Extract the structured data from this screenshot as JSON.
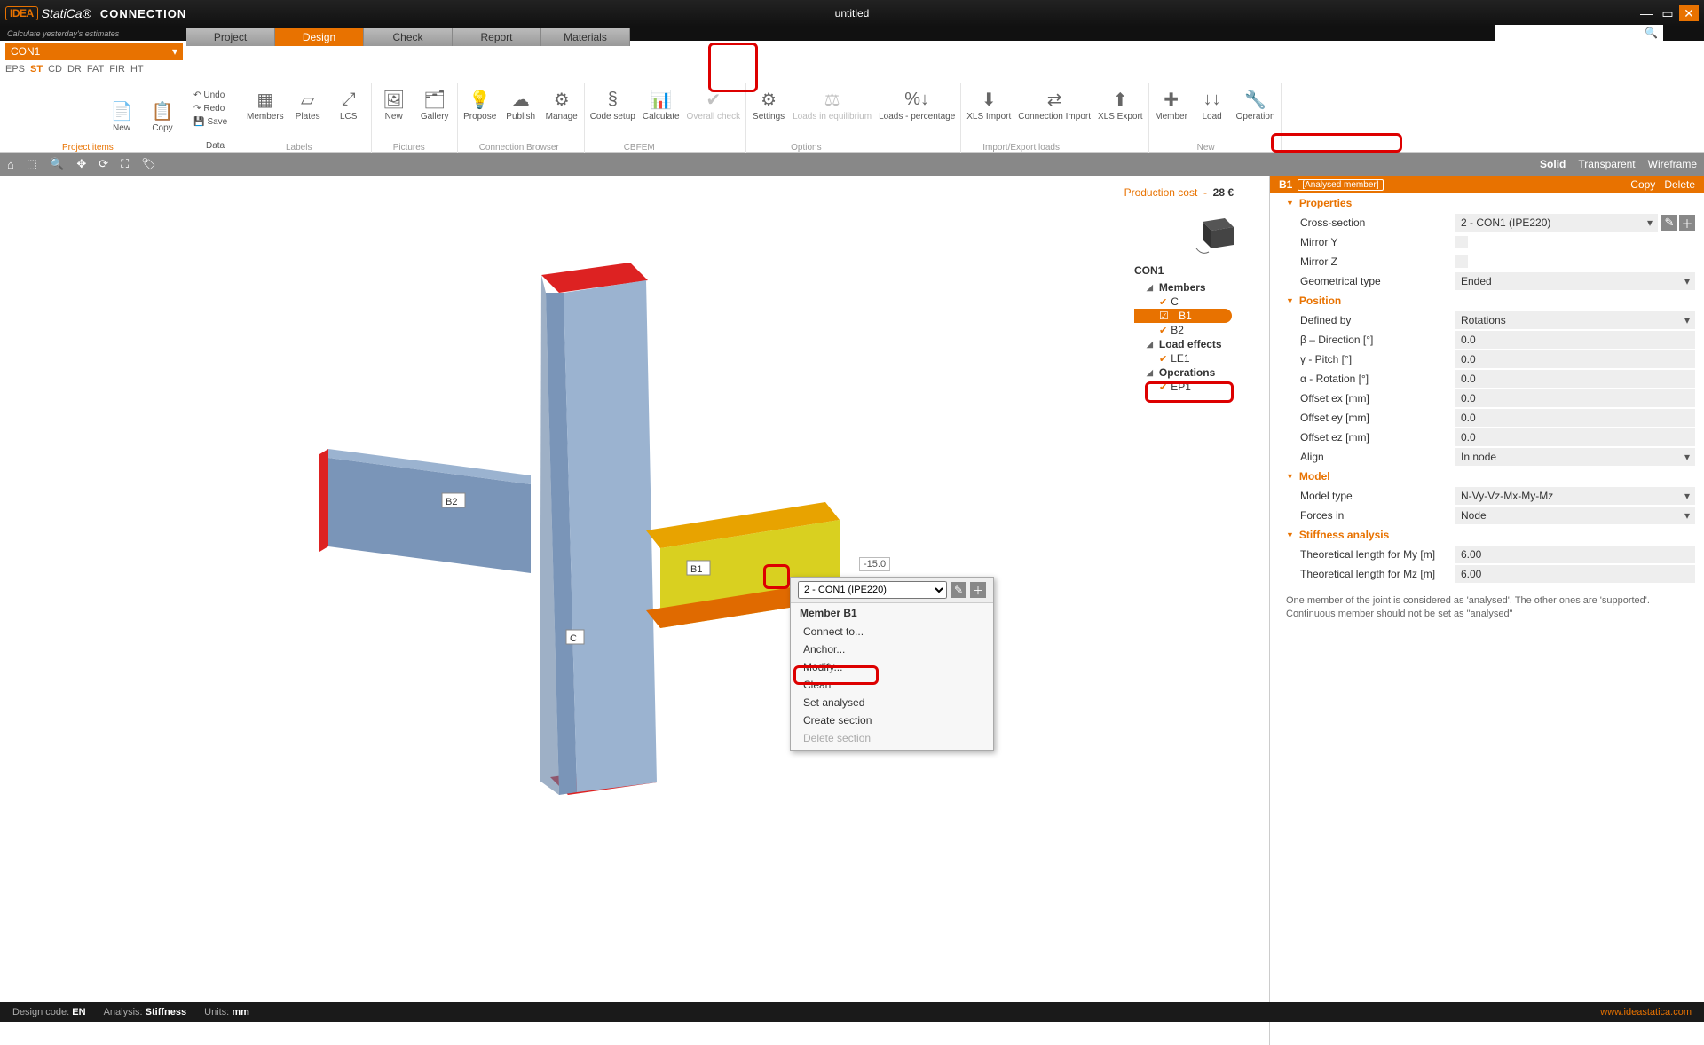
{
  "titlebar": {
    "logo": "IDEA",
    "brand": "StatiCa®",
    "app": "CONNECTION",
    "doc": "untitled",
    "tagline": "Calculate yesterday's estimates"
  },
  "tabs": [
    "Project",
    "Design",
    "Check",
    "Report",
    "Materials"
  ],
  "active_tab": 1,
  "name_box": "CON1",
  "sublabels": [
    "EPS",
    "ST",
    "CD",
    "DR",
    "FAT",
    "FIR",
    "HT"
  ],
  "project_items_label": "Project items",
  "ribbon": {
    "new": "New",
    "copy": "Copy",
    "undo": "Undo",
    "redo": "Redo",
    "save": "Save",
    "members": "Members",
    "plates": "Plates",
    "lcs": "LCS",
    "new2": "New",
    "gallery": "Gallery",
    "propose": "Propose",
    "publish": "Publish",
    "manage": "Manage",
    "codesetup": "Code setup",
    "calculate": "Calculate",
    "overallcheck": "Overall check",
    "settings": "Settings",
    "loadseq": "Loads in equilibrium",
    "loadspct": "Loads - percentage",
    "xlsimp": "XLS Import",
    "connimp": "Connection Import",
    "xlsexp": "XLS Export",
    "member": "Member",
    "load": "Load",
    "operation": "Operation",
    "g_data": "Data",
    "g_labels": "Labels",
    "g_pictures": "Pictures",
    "g_cb": "Connection Browser",
    "g_cbfem": "CBFEM",
    "g_options": "Options",
    "g_ie": "Import/Export loads",
    "g_new": "New"
  },
  "toolbar2": {
    "solid": "Solid",
    "transparent": "Transparent",
    "wireframe": "Wireframe"
  },
  "prod_cost": {
    "label": "Production cost",
    "sep": "-",
    "value": "28 €"
  },
  "tree": {
    "root": "CON1",
    "members": "Members",
    "c": "C",
    "b1": "B1",
    "b2": "B2",
    "le": "Load effects",
    "le1": "LE1",
    "ops": "Operations",
    "ep1": "EP1"
  },
  "dim": "-15.0",
  "beam_labels": {
    "b1": "B1",
    "b2": "B2",
    "c": "C"
  },
  "props_head": {
    "member": "B1",
    "tag": "[Analysed member]",
    "copy": "Copy",
    "delete": "Delete"
  },
  "props": {
    "s_props": "Properties",
    "cross": "Cross-section",
    "cross_v": "2 - CON1 (IPE220)",
    "my": "Mirror Y",
    "mz": "Mirror Z",
    "geo": "Geometrical type",
    "geo_v": "Ended",
    "s_pos": "Position",
    "def": "Defined by",
    "def_v": "Rotations",
    "beta": "β – Direction [°]",
    "beta_v": "0.0",
    "gamma": "γ - Pitch [°]",
    "gamma_v": "0.0",
    "alpha": "α - Rotation [°]",
    "alpha_v": "0.0",
    "ox": "Offset ex [mm]",
    "ox_v": "0.0",
    "oy": "Offset ey [mm]",
    "oy_v": "0.0",
    "oz": "Offset ez [mm]",
    "oz_v": "0.0",
    "align": "Align",
    "align_v": "In node",
    "s_model": "Model",
    "mt": "Model type",
    "mt_v": "N-Vy-Vz-Mx-My-Mz",
    "fi": "Forces in",
    "fi_v": "Node",
    "s_stiff": "Stiffness analysis",
    "tly": "Theoretical length for My [m]",
    "tly_v": "6.00",
    "tlz": "Theoretical length for Mz [m]",
    "tlz_v": "6.00",
    "note": "One member of the joint is considered as 'analysed'. The other ones are 'supported'. Continuous member should not be set as \"analysed\""
  },
  "ctx": {
    "cs": "2 - CON1 (IPE220)",
    "title": "Member B1",
    "items": [
      "Connect to...",
      "Anchor...",
      "Modify...",
      "Clean",
      "Set analysed",
      "Create section",
      "Delete section"
    ]
  },
  "status": {
    "dc_l": "Design code:",
    "dc": "EN",
    "an_l": "Analysis:",
    "an": "Stiffness",
    "un_l": "Units:",
    "un": "mm",
    "site": "www.ideastatica.com"
  }
}
